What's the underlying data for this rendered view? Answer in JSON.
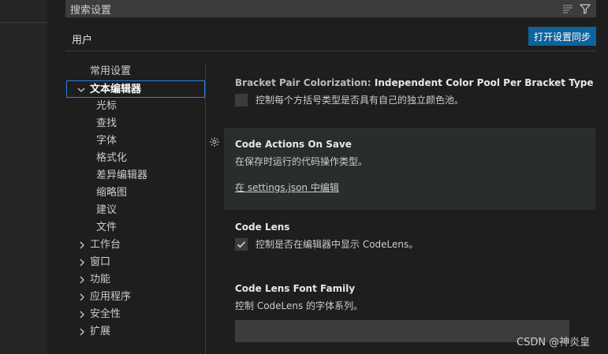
{
  "search": {
    "placeholder": "搜索设置"
  },
  "tabs": {
    "user": "用户"
  },
  "sync_button": "打开设置同步",
  "toc": {
    "common": "常用设置",
    "text_editor": "文本编辑器",
    "text_editor_children": [
      "光标",
      "查找",
      "字体",
      "格式化",
      "差异编辑器",
      "缩略图",
      "建议",
      "文件"
    ],
    "collapsed": [
      "工作台",
      "窗口",
      "功能",
      "应用程序",
      "安全性",
      "扩展"
    ]
  },
  "settings": {
    "bracket": {
      "category": "Bracket Pair Colorization: ",
      "name": "Independent Color Pool Per Bracket Type",
      "description": "控制每个方括号类型是否具有自己的独立颜色池。",
      "checked": false
    },
    "code_actions": {
      "name": "Code Actions On Save",
      "description": "在保存时运行的代码操作类型。",
      "link": "在 settings.json 中编辑"
    },
    "code_lens": {
      "name": "Code Lens",
      "description": "控制是否在编辑器中显示 CodeLens。",
      "checked": true
    },
    "code_lens_font": {
      "name": "Code Lens Font Family",
      "description": "控制 CodeLens 的字体系列。",
      "value": ""
    }
  },
  "watermark": "CSDN @神炎皇",
  "colors": {
    "accent": "#0e639c",
    "focus_border": "#2b7fd7",
    "background": "#1e1e1e"
  },
  "icons": {
    "filter_lines": "clear-filter-icon",
    "filter": "filter-icon",
    "gear": "gear-icon"
  }
}
